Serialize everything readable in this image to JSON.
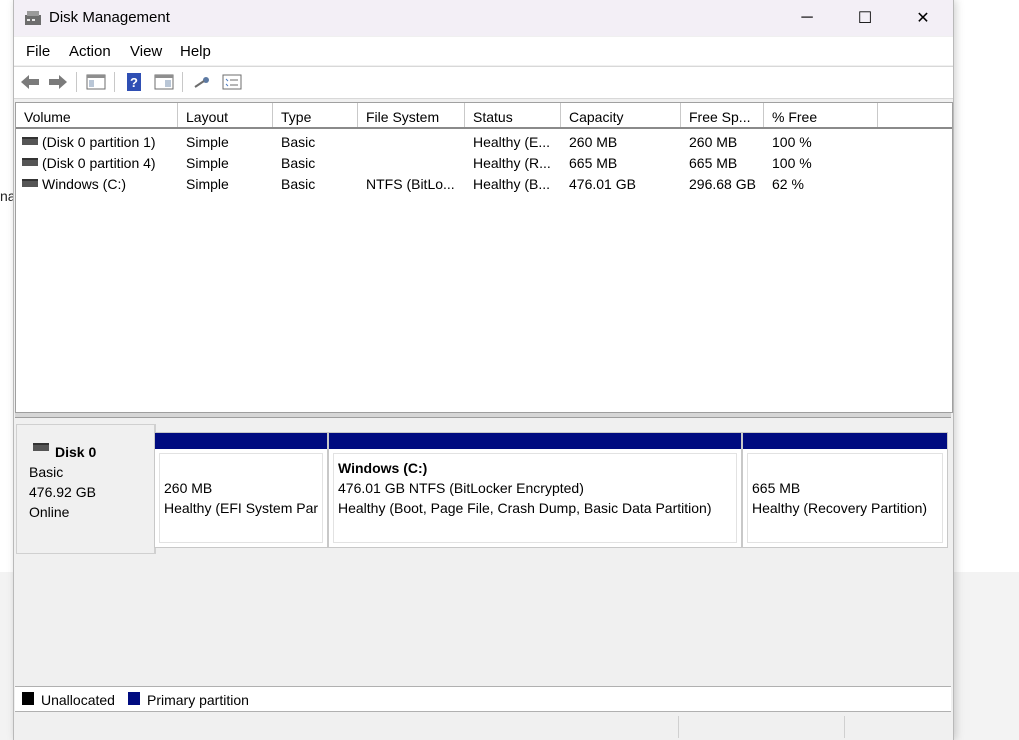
{
  "background": {
    "partial_text": "na"
  },
  "window": {
    "title": "Disk Management",
    "icon": "disk-management-icon",
    "controls": {
      "minimize": "─",
      "maximize": "☐",
      "close": "✕"
    }
  },
  "menu": [
    "File",
    "Action",
    "View",
    "Help"
  ],
  "toolbar": {
    "icons": [
      "back-icon",
      "forward-icon",
      "console-tree-icon",
      "help-icon",
      "properties-icon",
      "key-icon",
      "checklist-icon"
    ]
  },
  "volume_list": {
    "columns": [
      "Volume",
      "Layout",
      "Type",
      "File System",
      "Status",
      "Capacity",
      "Free Sp...",
      "% Free"
    ],
    "rows": [
      [
        "(Disk 0 partition 1)",
        "Simple",
        "Basic",
        "",
        "Healthy (E...",
        "260 MB",
        "260 MB",
        "100 %"
      ],
      [
        "(Disk 0 partition 4)",
        "Simple",
        "Basic",
        "",
        "Healthy (R...",
        "665 MB",
        "665 MB",
        "100 %"
      ],
      [
        "Windows (C:)",
        "Simple",
        "Basic",
        "NTFS (BitLo...",
        "Healthy (B...",
        "476.01 GB",
        "296.68 GB",
        "62 %"
      ]
    ]
  },
  "disk": {
    "name": "Disk 0",
    "type": "Basic",
    "size": "476.92 GB",
    "status": "Online",
    "partitions": [
      {
        "title": "",
        "line1": "260 MB",
        "line2": "Healthy (EFI System Par"
      },
      {
        "title": "Windows  (C:)",
        "line1": "476.01 GB NTFS (BitLocker Encrypted)",
        "line2": "Healthy (Boot, Page File, Crash Dump, Basic Data Partition)"
      },
      {
        "title": "",
        "line1": "665 MB",
        "line2": "Healthy (Recovery Partition)"
      }
    ]
  },
  "legend": {
    "items": [
      {
        "label": "Unallocated",
        "color": "#000000"
      },
      {
        "label": "Primary partition",
        "color": "#000b80"
      }
    ]
  }
}
